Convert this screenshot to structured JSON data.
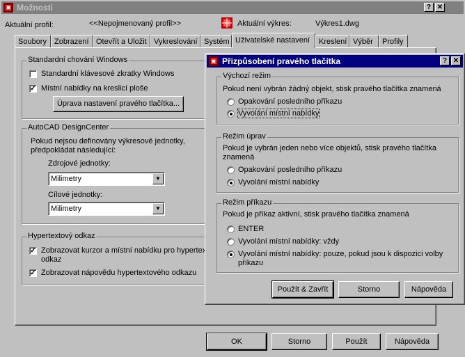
{
  "main": {
    "title": "Možnosti",
    "help_btn": "?",
    "close_btn": "✕",
    "profile_label": "Aktuální profil:",
    "profile_value": "<<Nepojmenovaný profil>>",
    "drawing_label": "Aktuální výkres:",
    "drawing_value": "Výkres1.dwg",
    "tabs": [
      "Soubory",
      "Zobrazení",
      "Otevřít a Uložit",
      "Vykreslování",
      "Systém",
      "Uživatelské nastavení",
      "Kreslení",
      "Výběr",
      "Profily"
    ],
    "win_group": {
      "title": "Standardní chování Windows",
      "chk1": "Standardní klávesové zkratky Windows",
      "chk2": "Místní nabídky na kreslicí ploše",
      "button": "Úprava nastavení pravého tlačítka..."
    },
    "dc_group": {
      "title": "AutoCAD DesignCenter",
      "desc1": "Pokud nejsou definovány výkresové jednotky,",
      "desc2": "předpokládat následující:",
      "source_label": "Zdrojové jednotky:",
      "source_value": "Milimetry",
      "target_label": "Cílové jednotky:",
      "target_value": "Milimetry"
    },
    "hyper_group": {
      "title": "Hypertextový odkaz",
      "chk1_line1": "Zobrazovat kurzor a místní nabídku pro hypertexto",
      "chk1_line2": "odkaz",
      "chk2": "Zobrazovat nápovědu hypertextového odkazu"
    },
    "ok": "OK",
    "cancel": "Storno",
    "apply": "Použít",
    "help": "Nápověda"
  },
  "dialog": {
    "title": "Přizpůsobení pravého tlačítka",
    "help_btn": "?",
    "close_btn": "✕",
    "default_group": {
      "title": "Výchozí režim",
      "desc": "Pokud není vybrán žádný objekt, stisk pravého tlačítka znamená",
      "opt1": "Opakování posledního příkazu",
      "opt2": "Vyvolání místní nabídky"
    },
    "edit_group": {
      "title": "Režim úprav",
      "desc1": "Pokud je vybrán jeden nebo více objektů, stisk pravého tlačítka",
      "desc2": "znamená",
      "opt1": "Opakování posledního příkazu",
      "opt2": "Vyvolání místní nabídky"
    },
    "command_group": {
      "title": "Režim příkazu",
      "desc": "Pokud je příkaz aktivní, stisk pravého tlačítka znamená",
      "opt1": "ENTER",
      "opt2": "Vyvolání místní nabídky: vždy",
      "opt3_line1": "Vyvolání místní nabídky: pouze, pokud jsou k dispozici volby",
      "opt3_line2": "příkazu"
    },
    "apply_close": "Použít & Zavřít",
    "cancel": "Storno",
    "help": "Nápověda"
  }
}
